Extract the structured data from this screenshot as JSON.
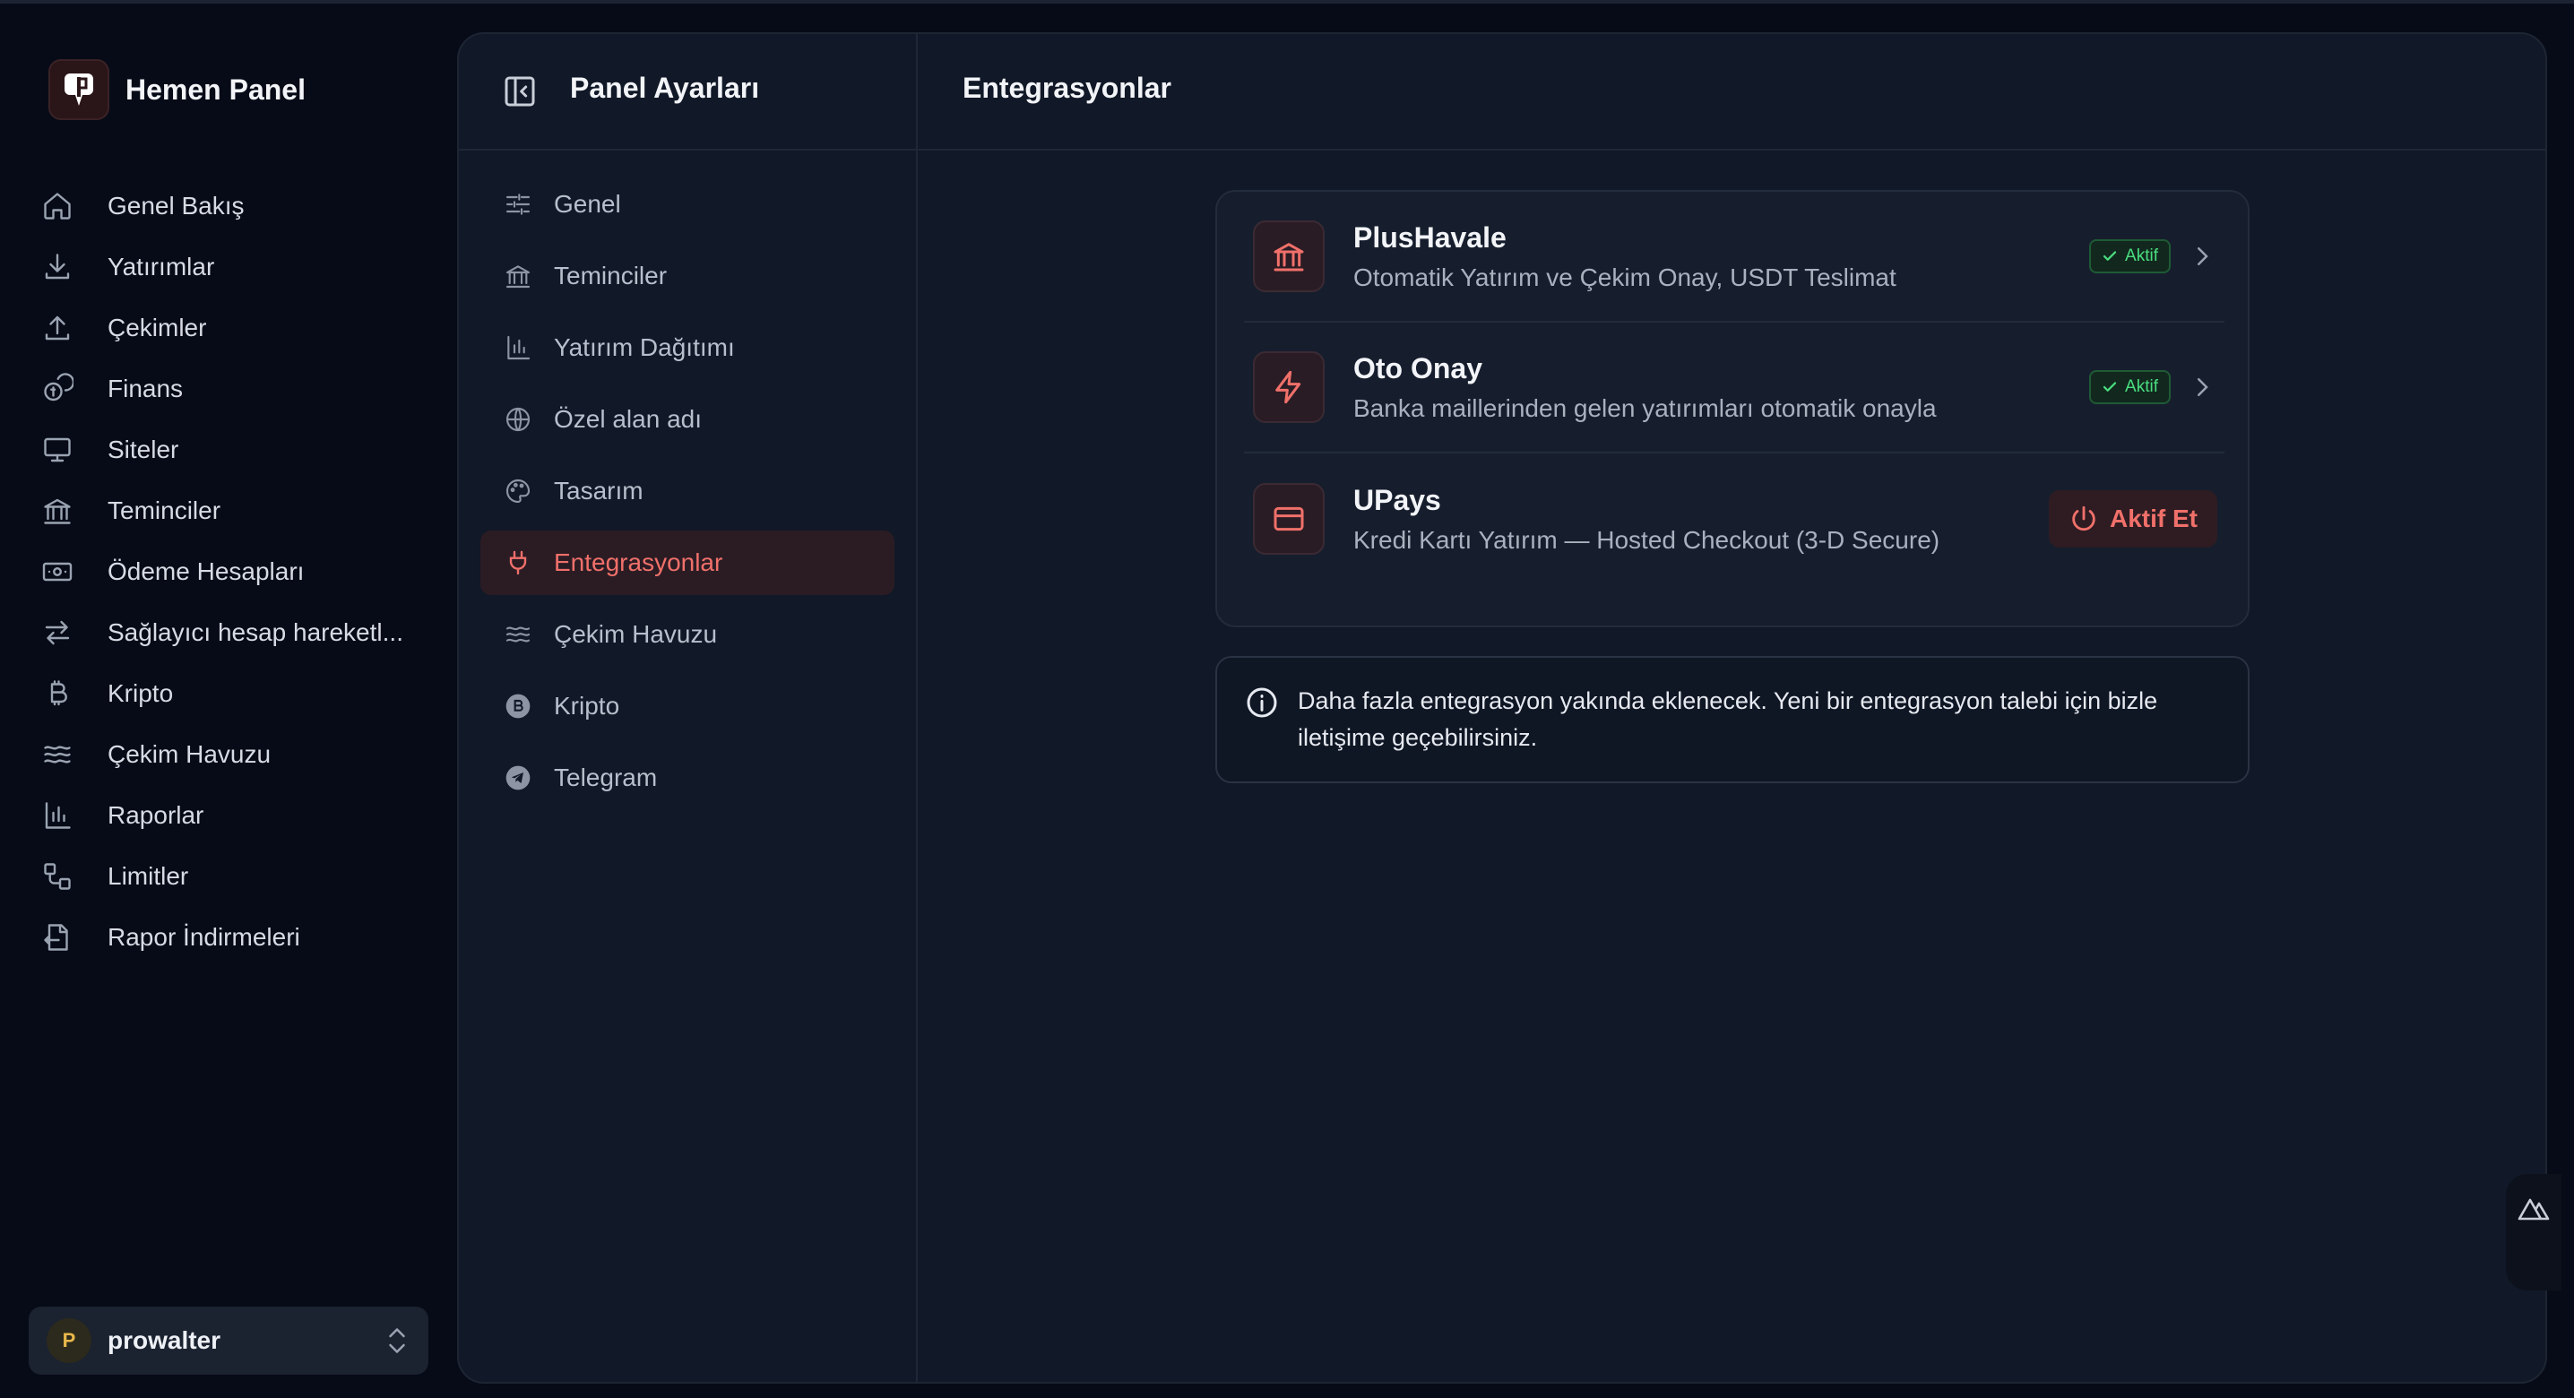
{
  "brand": {
    "name": "Hemen Panel"
  },
  "sidebar": {
    "items": [
      {
        "label": "Genel Bakış",
        "icon": "home-icon"
      },
      {
        "label": "Yatırımlar",
        "icon": "download-icon"
      },
      {
        "label": "Çekimler",
        "icon": "upload-icon"
      },
      {
        "label": "Finans",
        "icon": "coins-icon"
      },
      {
        "label": "Siteler",
        "icon": "monitor-icon"
      },
      {
        "label": "Teminciler",
        "icon": "bank-icon"
      },
      {
        "label": "Ödeme Hesapları",
        "icon": "banknote-icon"
      },
      {
        "label": "Sağlayıcı hesap hareketl...",
        "icon": "arrows-icon"
      },
      {
        "label": "Kripto",
        "icon": "bitcoin-icon"
      },
      {
        "label": "Çekim Havuzu",
        "icon": "waves-icon"
      },
      {
        "label": "Raporlar",
        "icon": "bar-chart-icon"
      },
      {
        "label": "Limitler",
        "icon": "workflow-icon"
      },
      {
        "label": "Rapor İndirmeleri",
        "icon": "file-export-icon"
      }
    ]
  },
  "user": {
    "initial": "P",
    "name": "prowalter"
  },
  "settings": {
    "title": "Panel Ayarları",
    "items": [
      {
        "label": "Genel",
        "icon": "sliders-icon"
      },
      {
        "label": "Teminciler",
        "icon": "bank-icon"
      },
      {
        "label": "Yatırım Dağıtımı",
        "icon": "bar-chart-icon"
      },
      {
        "label": "Özel alan adı",
        "icon": "globe-icon"
      },
      {
        "label": "Tasarım",
        "icon": "palette-icon"
      },
      {
        "label": "Entegrasyonlar",
        "icon": "plug-icon",
        "active": true
      },
      {
        "label": "Çekim Havuzu",
        "icon": "waves-icon"
      },
      {
        "label": "Kripto",
        "icon": "bitcoin-icon"
      },
      {
        "label": "Telegram",
        "icon": "telegram-icon"
      }
    ]
  },
  "content": {
    "title": "Entegrasyonlar",
    "integrations": [
      {
        "name": "PlusHavale",
        "desc": "Otomatik Yatırım ve Çekim Onay, USDT Teslimat",
        "status": "Aktif",
        "icon": "bank-icon"
      },
      {
        "name": "Oto Onay",
        "desc": "Banka maillerinden gelen yatırımları otomatik onayla",
        "status": "Aktif",
        "icon": "zap-icon"
      },
      {
        "name": "UPays",
        "desc": "Kredi Kartı Yatırım — Hosted Checkout (3-D Secure)",
        "action": "Aktif Et",
        "icon": "credit-card-icon"
      }
    ],
    "info": "Daha fazla entegrasyon yakında eklenecek. Yeni bir entegrasyon talebi için bizle iletişime geçebilirsiniz."
  },
  "colors": {
    "accent": "#f0706a",
    "success": "#4ade80",
    "panel": "#111827"
  }
}
